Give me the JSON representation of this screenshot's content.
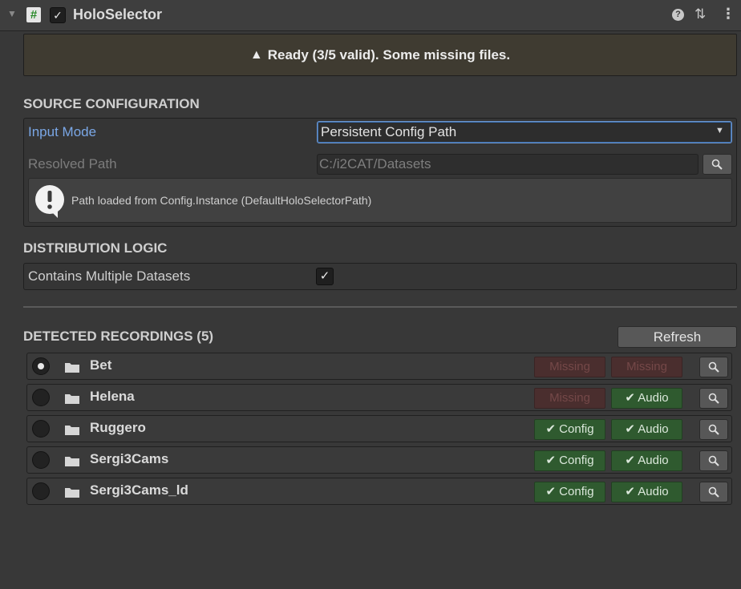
{
  "header": {
    "script_icon_glyph": "#",
    "title": "HoloSelector",
    "icons": [
      "foldout-arrow-icon",
      "script-icon",
      "enabled-checkbox",
      "help-icon",
      "presets-icon",
      "more-options-icon"
    ]
  },
  "status": {
    "text": "Ready (3/5 valid). Some missing files.",
    "icon": "warning-triangle-icon",
    "color": "#3f3b31"
  },
  "source": {
    "section_title": "SOURCE CONFIGURATION",
    "input_mode_label": "Input Mode",
    "input_mode_value": "Persistent Config Path",
    "resolved_label": "Resolved Path",
    "resolved_value": "C:/i2CAT/Datasets",
    "info_text": "Path loaded from Config.Instance (DefaultHoloSelectorPath)"
  },
  "distribution": {
    "section_title": "DISTRIBUTION LOGIC",
    "multi_label": "Contains Multiple Datasets",
    "multi_checked": true
  },
  "recordings": {
    "section_title": "DETECTED RECORDINGS (5)",
    "refresh_label": "Refresh",
    "items": [
      {
        "name": "Bet",
        "selected": true,
        "config": "Missing",
        "config_ok": false,
        "audio": "Missing",
        "audio_ok": false
      },
      {
        "name": "Helena",
        "selected": false,
        "config": "Missing",
        "config_ok": false,
        "audio": "✔ Audio",
        "audio_ok": true
      },
      {
        "name": "Ruggero",
        "selected": false,
        "config": "✔ Config",
        "config_ok": true,
        "audio": "✔ Audio",
        "audio_ok": true
      },
      {
        "name": "Sergi3Cams",
        "selected": false,
        "config": "✔ Config",
        "config_ok": true,
        "audio": "✔ Audio",
        "audio_ok": true
      },
      {
        "name": "Sergi3Cams_ld",
        "selected": false,
        "config": "✔ Config",
        "config_ok": true,
        "audio": "✔ Audio",
        "audio_ok": true
      }
    ]
  },
  "colors": {
    "accent": "#7aa7e6",
    "ok_badge": "#2f5a2f",
    "missing_badge": "#4a2e2e"
  }
}
